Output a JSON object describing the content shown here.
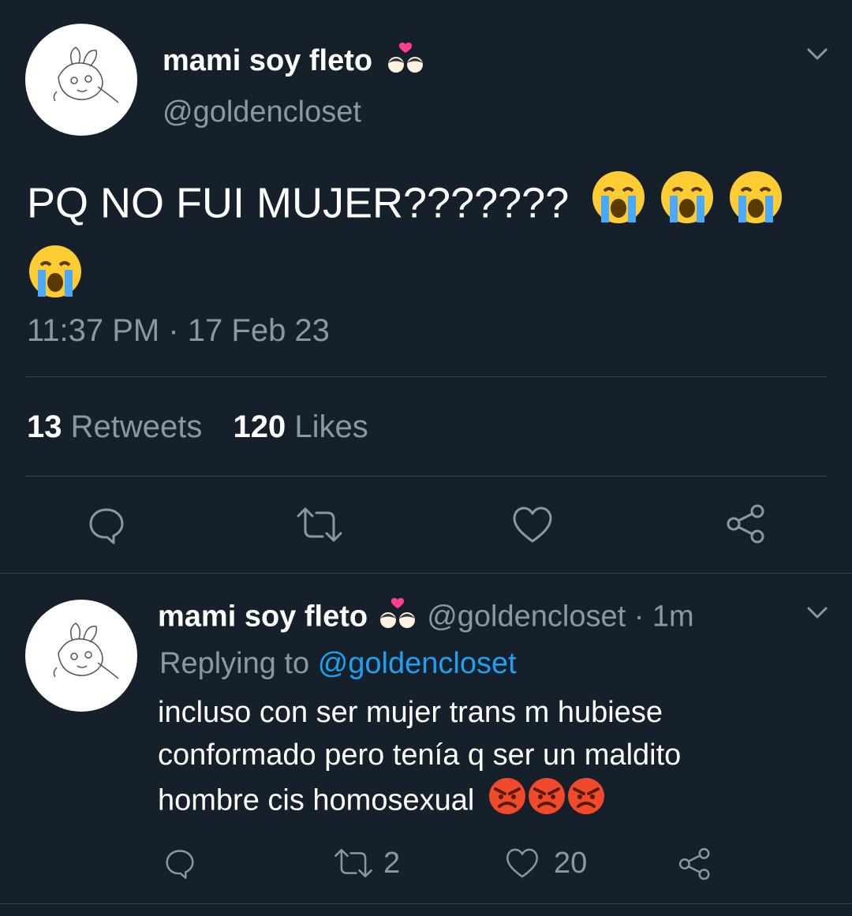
{
  "main_tweet": {
    "display_name": "mami soy fleto",
    "handle": "@goldencloset",
    "text": "PQ NO FUI MUJER???????",
    "timestamp": "11:37 PM · 17 Feb 23",
    "stats": {
      "retweets_count": "13",
      "retweets_label": "Retweets",
      "likes_count": "120",
      "likes_label": "Likes"
    }
  },
  "reply_tweet": {
    "display_name": "mami soy fleto",
    "handle_time": "@goldencloset · 1m",
    "replying_prefix": "Replying to",
    "replying_handle": "@goldencloset",
    "text_line1": "incluso con ser mujer trans m hubiese",
    "text_line2": "conformado pero tenía q ser un maldito",
    "text_line3": "hombre cis homosexual",
    "retweet_count": "2",
    "like_count": "20"
  },
  "icons": {
    "reply": "reply-icon",
    "retweet": "retweet-icon",
    "like": "heart-icon",
    "share": "share-icon",
    "more": "chevron-down-icon",
    "emoji_cry": "loudly-crying-face-emoji",
    "emoji_angry": "angry-face-emoji",
    "emoji_couple": "couple-with-heart-emoji"
  },
  "colors": {
    "background": "#15202b",
    "text": "#ffffff",
    "muted": "#8899a6",
    "link": "#1da1f2",
    "divider": "#38444d"
  }
}
